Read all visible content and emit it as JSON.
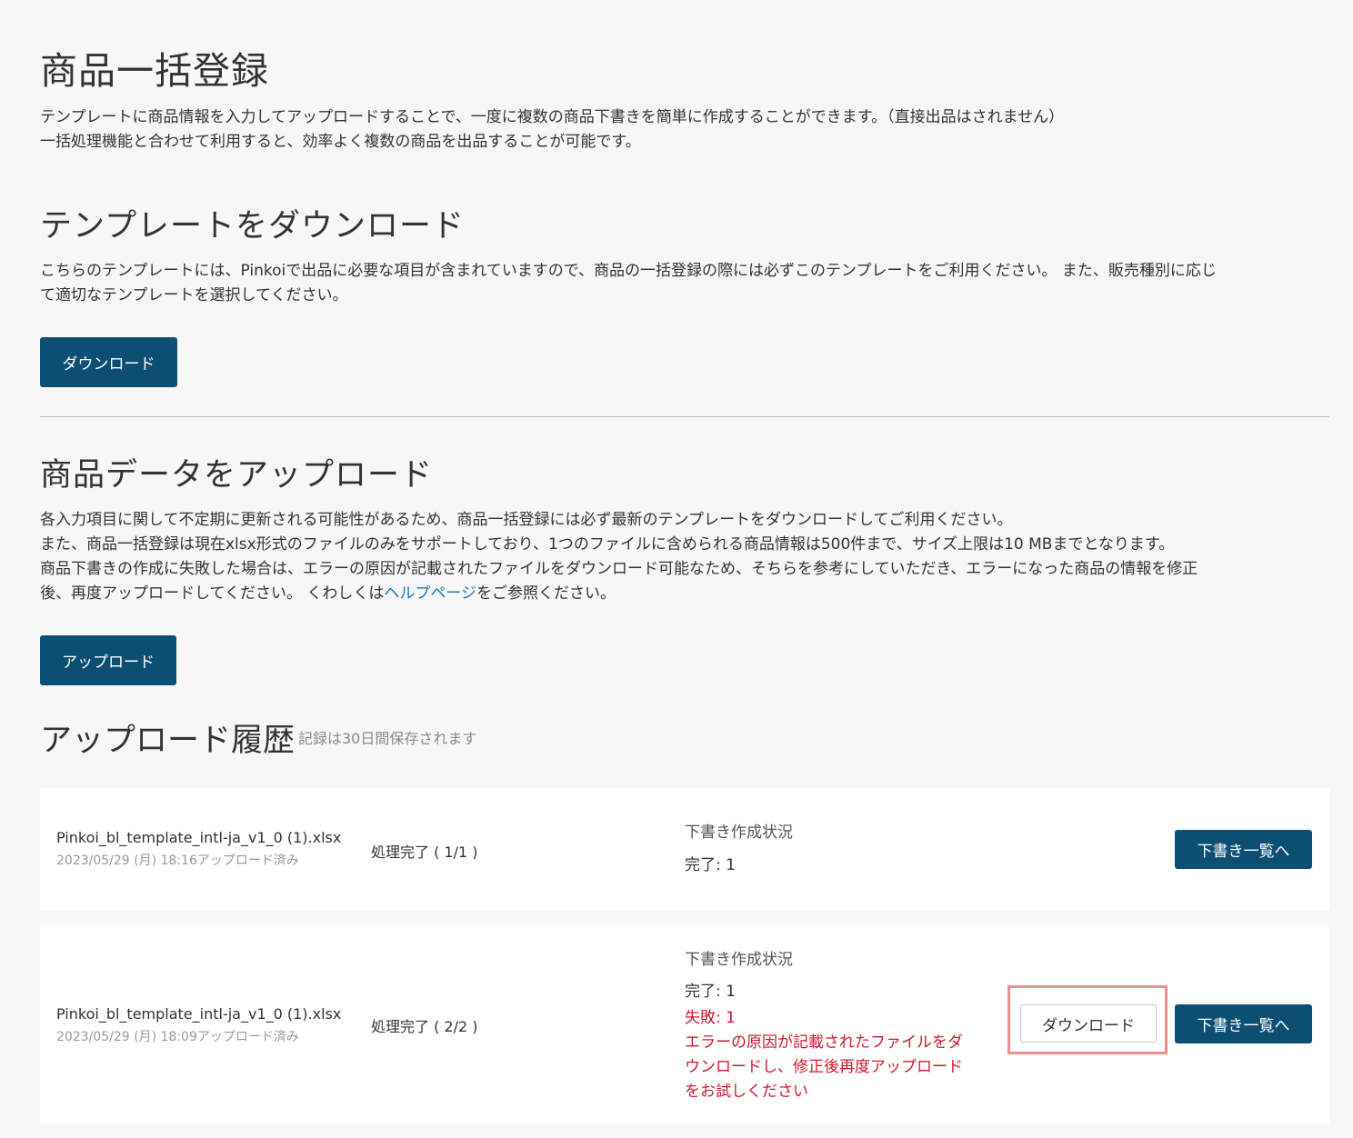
{
  "page": {
    "title": "商品一括登録",
    "intro_line1": "テンプレートに商品情報を入力してアップロードすることで、一度に複数の商品下書きを簡単に作成することができます。（直接出品はされません）",
    "intro_line2": "一括処理機能と合わせて利用すると、効率よく複数の商品を出品することが可能です。"
  },
  "template_section": {
    "heading": "テンプレートをダウンロード",
    "desc_line1": "こちらのテンプレートには、Pinkoiで出品に必要な項目が含まれていますので、商品の一括登録の際には必ずこのテンプレートをご利用ください。 また、販売種別に応じ",
    "desc_line2": "て適切なテンプレートを選択してください。",
    "download_label": "ダウンロード"
  },
  "upload_section": {
    "heading": "商品データをアップロード",
    "line1": "各入力項目に関して不定期に更新される可能性があるため、商品一括登録には必ず最新のテンプレートをダウンロードしてご利用ください。",
    "line2": "また、商品一括登録は現在xlsx形式のファイルのみをサポートしており、1つのファイルに含められる商品情報は500件まで、サイズ上限は10 MBまでとなります。",
    "line3": "商品下書きの作成に失敗した場合は、エラーの原因が記載されたファイルをダウンロード可能なため、そちらを参考にしていただき、エラーになった商品の情報を修正",
    "line4_pre": "後、再度アップロードしてください。 くわしくは",
    "help_link": "ヘルプページ",
    "line4_post": "をご参照ください。",
    "upload_label": "アップロード"
  },
  "history": {
    "heading": "アップロード履歴",
    "note": "記録は30日間保存されます",
    "rows": [
      {
        "filename": "Pinkoi_bl_template_intl-ja_v1_0 (1).xlsx",
        "uploaded": "2023/05/29 (月) 18:16アップロード済み",
        "process": "処理完了 ( 1/1 )",
        "status_label": "下書き作成状況",
        "complete": "完了: 1",
        "drafts_button": "下書き一覧へ"
      },
      {
        "filename": "Pinkoi_bl_template_intl-ja_v1_0 (1).xlsx",
        "uploaded": "2023/05/29 (月) 18:09アップロード済み",
        "process": "処理完了 ( 2/2 )",
        "status_label": "下書き作成状況",
        "complete": "完了: 1",
        "failed": "失敗: 1",
        "error_msg_1": "エラーの原因が記載されたファイルをダ",
        "error_msg_2": "ウンロードし、修正後再度アップロード",
        "error_msg_3": "をお試しください",
        "download_button": "ダウンロード",
        "drafts_button": "下書き一覧へ"
      }
    ]
  },
  "colors": {
    "primary": "#0d4f72",
    "error": "#d0192b",
    "link": "#1a7dbf",
    "highlight": "#ef8f8a"
  }
}
